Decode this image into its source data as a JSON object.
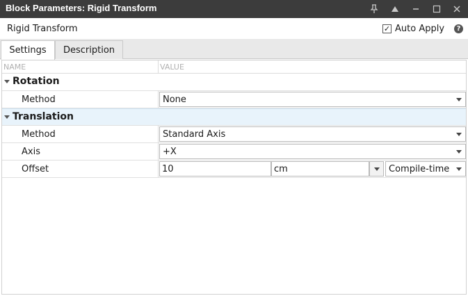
{
  "window": {
    "title": "Block Parameters: Rigid Transform",
    "controls": [
      "pin-icon",
      "collapse-icon",
      "minimize-icon",
      "maximize-icon",
      "close-icon"
    ]
  },
  "header": {
    "block_name": "Rigid Transform",
    "auto_apply_label": "Auto Apply",
    "auto_apply_checked": true,
    "auto_apply_mark": "✓",
    "help_glyph": "?"
  },
  "tabs": [
    {
      "label": "Settings",
      "active": true
    },
    {
      "label": "Description",
      "active": false
    }
  ],
  "grid": {
    "columns": {
      "name": "NAME",
      "value": "VALUE"
    },
    "rotation": {
      "group": "Rotation",
      "method_label": "Method",
      "method_value": "None"
    },
    "translation": {
      "group": "Translation",
      "method_label": "Method",
      "method_value": "Standard Axis",
      "axis_label": "Axis",
      "axis_value": "+X",
      "offset_label": "Offset",
      "offset_value": "10",
      "offset_unit": "cm",
      "offset_mode": "Compile-time"
    }
  },
  "colors": {
    "titlebar_bg": "#3c3c3c",
    "selected_row_bg": "#e8f3fb",
    "tab_strip_bg": "#e9e9e9"
  }
}
